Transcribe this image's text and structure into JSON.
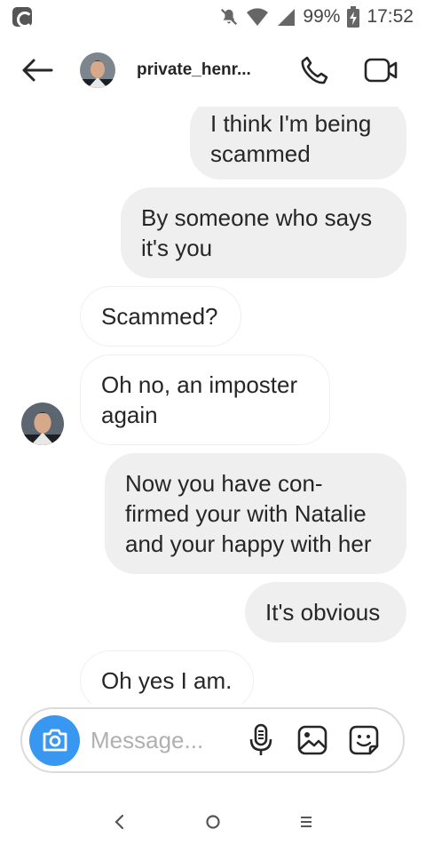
{
  "status_bar": {
    "battery_percent": "99%",
    "time": "17:52"
  },
  "header": {
    "username": "private_henr...",
    "back_icon": "arrow-left-icon",
    "call_icon": "phone-icon",
    "video_icon": "video-camera-icon"
  },
  "messages": [
    {
      "direction": "out",
      "text": "I think I'm being scammed"
    },
    {
      "direction": "out",
      "text": "By someone who says it's you"
    },
    {
      "direction": "in",
      "text": "Scammed?"
    },
    {
      "direction": "in",
      "text": "Oh no, an imposter again"
    },
    {
      "direction": "out",
      "text": "Now you have con-firmed your with Natalie and your happy with her"
    },
    {
      "direction": "out",
      "text": "It's obvious"
    },
    {
      "direction": "in",
      "text": "Oh yes I am."
    }
  ],
  "composer": {
    "placeholder": "Message...",
    "value": "",
    "accent_color": "#3897f0"
  },
  "colors": {
    "outgoing_bubble": "#efefef",
    "incoming_border": "#efefef",
    "text": "#262626"
  }
}
